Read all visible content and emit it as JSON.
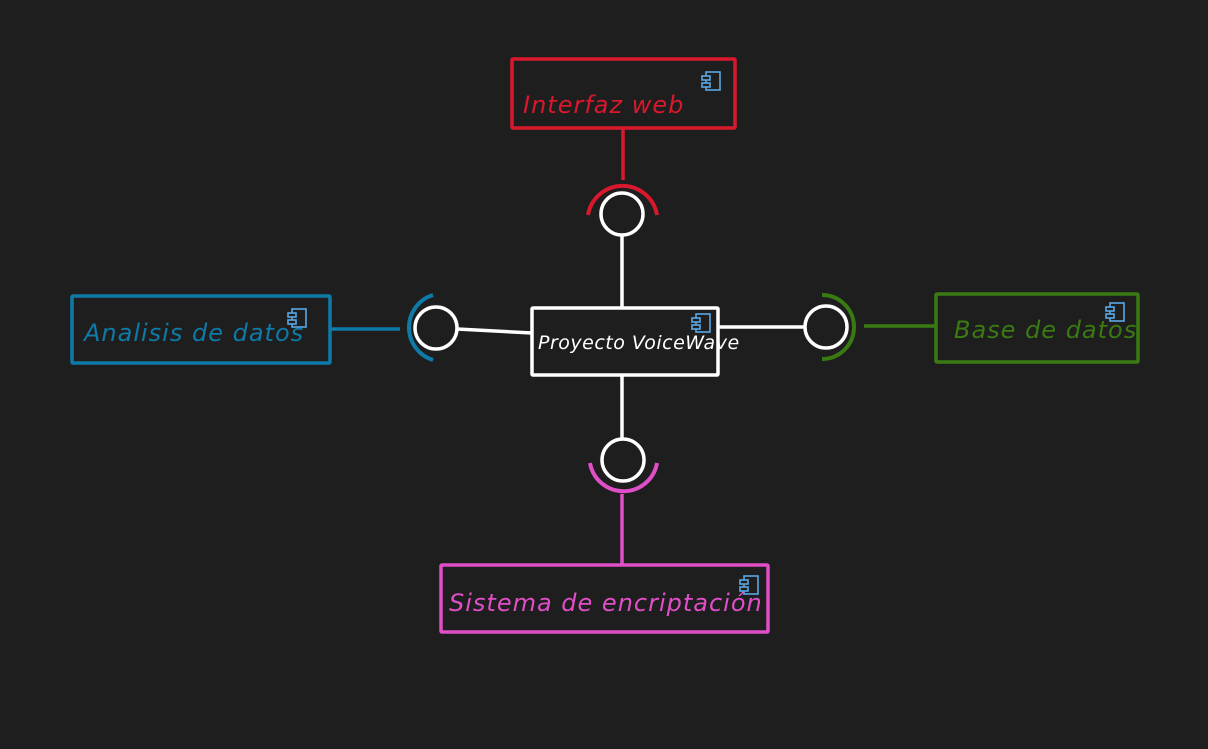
{
  "center": {
    "label": "Proyecto VoiceWave",
    "color": "#ffffff"
  },
  "components": [
    {
      "key": "web",
      "label": "Interfaz web",
      "color": "#d9182d"
    },
    {
      "key": "analisis",
      "label": "Analisis de datos",
      "color": "#0e7aa7"
    },
    {
      "key": "bd",
      "label": "Base de datos",
      "color": "#3a7a12"
    },
    {
      "key": "enc",
      "label": "Sistema de encriptación",
      "color": "#e04fc8"
    }
  ],
  "icon": {
    "name": "component-icon",
    "color": "#5aa7e6"
  },
  "background": "#1e1e1e"
}
